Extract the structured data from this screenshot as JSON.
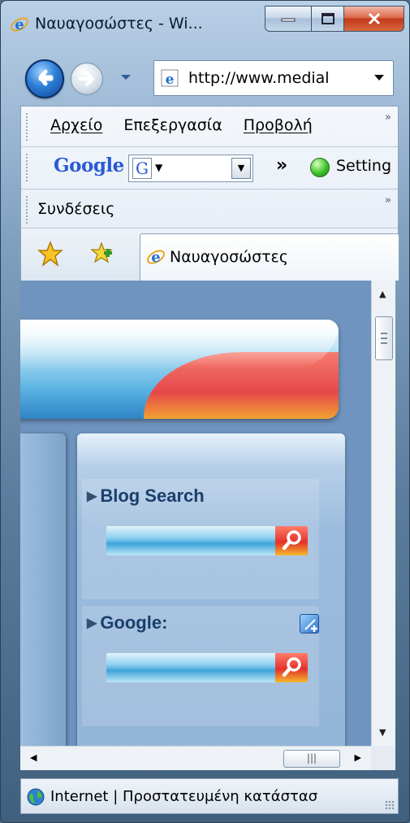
{
  "window": {
    "title": "Ναυαγοσώστες - Wi..."
  },
  "address_bar": {
    "url": "http://www.medial"
  },
  "menu": {
    "items": [
      "Αρχείο",
      "Επεξεργασία",
      "Προβολή"
    ]
  },
  "google_toolbar": {
    "logo": "Google",
    "badge": "G",
    "settings_label": "Setting"
  },
  "links_bar": {
    "label": "Συνδέσεις"
  },
  "tab": {
    "title": "Ναυαγοσώστες"
  },
  "content": {
    "widgets": [
      {
        "title": "Blog Search"
      },
      {
        "title": "Google:"
      }
    ]
  },
  "status_bar": {
    "text": "Internet | Προστατευμένη κατάστασ"
  },
  "colors": {
    "page_background": "#6e94bf",
    "header_red": "#e5484a",
    "header_blue": "#5ab3e3",
    "widget_title": "#1b3f6b",
    "settings_green": "#3cc32a"
  }
}
